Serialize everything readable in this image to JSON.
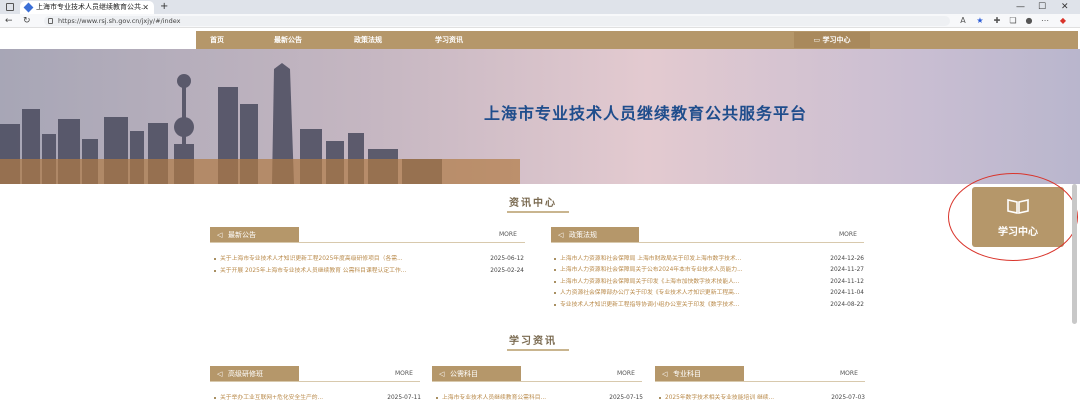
{
  "browser": {
    "tab_title": "上海市专业技术人员继续教育公共...",
    "new_tab": "+",
    "url": "https://www.rsj.sh.gov.cn/jxjy/#/index",
    "window_controls": [
      "—",
      "☐",
      "✕"
    ]
  },
  "nav": {
    "items": [
      "首页",
      "最新公告",
      "政策法规",
      "学习资讯"
    ],
    "study_center": "学习中心"
  },
  "banner": {
    "title": "上海市专业技术人员继续教育公共服务平台"
  },
  "info_center": {
    "title": "资讯中心",
    "announcements": {
      "title": "最新公告",
      "more": "MORE",
      "rows": [
        {
          "title": "关于上海市专业技术人才知识更新工程2025年度高级研修项目（各需...",
          "date": "2025-06-12"
        },
        {
          "title": "关于开展 2025年上海市专业技术人员继续教育 公需科目课程认定工作...",
          "date": "2025-02-24"
        }
      ]
    },
    "policies": {
      "title": "政策法规",
      "more": "MORE",
      "rows": [
        {
          "title": "上海市人力资源和社会保障局 上海市财政局关于印发上海市数字技术...",
          "date": "2024-12-26"
        },
        {
          "title": "上海市人力资源和社会保障局关于公布2024年本市专业技术人员能力...",
          "date": "2024-11-27"
        },
        {
          "title": "上海市人力资源和社会保障局关于印发《上海市加快数字技术技能人...",
          "date": "2024-11-12"
        },
        {
          "title": "人力资源社会保障部办公厅关于印发《专业技术人才知识更新工程高...",
          "date": "2024-11-04"
        },
        {
          "title": "专业技术人才知识更新工程指导协调小组办公室关于印发《数字技术...",
          "date": "2024-08-22"
        }
      ]
    }
  },
  "study_info": {
    "title": "学习资讯",
    "columns": [
      {
        "title": "高级研修班",
        "more": "MORE",
        "rows": [
          {
            "title": "关于举办工业互联网+危化安全生产的...",
            "date": "2025-07-11"
          }
        ]
      },
      {
        "title": "公需科目",
        "more": "MORE",
        "rows": [
          {
            "title": "上海市专业技术人员继续教育公需科目...",
            "date": "2025-07-15"
          }
        ]
      },
      {
        "title": "专业科目",
        "more": "MORE",
        "rows": [
          {
            "title": "2025年数字技术相关专业技能培训 继续...",
            "date": "2025-07-03"
          }
        ]
      }
    ]
  },
  "float": {
    "label": "学习中心"
  },
  "colors": {
    "accent": "#b5976a",
    "title_blue": "#1f4d8c",
    "highlight": "#d9342b"
  },
  "icons": {
    "speaker": "speaker-icon",
    "book": "book-icon"
  }
}
